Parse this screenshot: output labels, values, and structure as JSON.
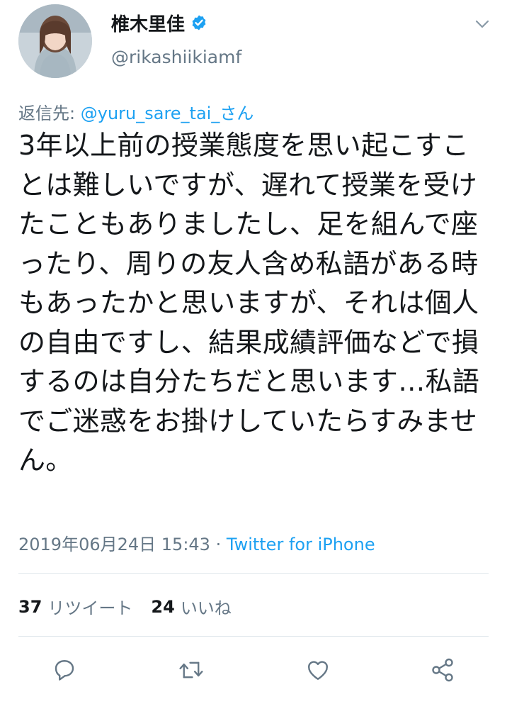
{
  "user": {
    "display_name": "椎木里佳",
    "handle": "@rikashiikiamf",
    "avatar": "profile-photo"
  },
  "icons": {
    "verified": "verified-badge-icon",
    "more": "chevron-down-icon",
    "reply": "reply-icon",
    "retweet": "retweet-icon",
    "like": "heart-icon",
    "share": "share-icon"
  },
  "reply": {
    "prefix": "返信先:",
    "mention": "@yuru_sare_tai_さん"
  },
  "tweet": {
    "text": "3年以上前の授業態度を思い起こすことは難しいですが、遅れて授業を受けたこともありましたし、足を組んで座ったり、周りの友人含め私語がある時もあったかと思いますが、それは個人の自由ですし、結果成績評価などで損するのは自分たちだと思います…私語でご迷惑をお掛けしていたらすみません。"
  },
  "meta": {
    "timestamp": "2019年06月24日 15:43",
    "separator": "·",
    "source": "Twitter for iPhone"
  },
  "stats": {
    "retweets_count": "37",
    "retweets_label": "リツイート",
    "likes_count": "24",
    "likes_label": "いいね"
  },
  "colors": {
    "accent": "#1da1f2",
    "secondary_text": "#657786",
    "primary_text": "#14171a",
    "divider": "#e1e8ed"
  }
}
